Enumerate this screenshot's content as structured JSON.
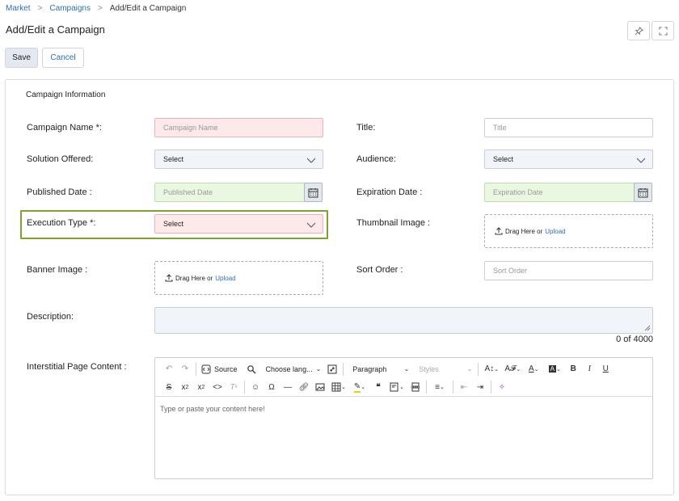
{
  "breadcrumb": {
    "items": [
      "Market",
      "Campaigns"
    ],
    "current": "Add/Edit a Campaign"
  },
  "page": {
    "title": "Add/Edit a Campaign"
  },
  "actions": {
    "save": "Save",
    "cancel": "Cancel"
  },
  "section": {
    "title": "Campaign Information"
  },
  "form": {
    "campaign_name": {
      "label": "Campaign Name *:",
      "placeholder": "Campaign Name"
    },
    "title": {
      "label": "Title:",
      "placeholder": "Title"
    },
    "solution_offered": {
      "label": "Solution Offered:",
      "value": "Select"
    },
    "audience": {
      "label": "Audience:",
      "value": "Select"
    },
    "published_date": {
      "label": "Published Date :",
      "placeholder": "Published Date"
    },
    "expiration_date": {
      "label": "Expiration Date :",
      "placeholder": "Expiration Date"
    },
    "execution_type": {
      "label": "Execution Type *:",
      "value": "Select"
    },
    "thumbnail_image": {
      "label": "Thumbnail Image :",
      "drag": "Drag Here or",
      "upload": "Upload"
    },
    "banner_image": {
      "label": "Banner Image :",
      "drag": "Drag Here or",
      "upload": "Upload"
    },
    "sort_order": {
      "label": "Sort Order :",
      "placeholder": "Sort Order"
    },
    "description": {
      "label": "Description:",
      "counter": "0 of 4000"
    },
    "interstitial": {
      "label": "Interstitial Page Content :",
      "placeholder": "Type or paste your content here!",
      "toolbar": {
        "source": "Source",
        "language": "Choose lang...",
        "paragraph": "Paragraph",
        "styles": "Styles"
      }
    }
  },
  "colors": {
    "link": "#2c6fb4",
    "required_bg": "#fde8ea",
    "date_bg": "#eaf8e2",
    "highlight_border": "#7ca32b"
  }
}
